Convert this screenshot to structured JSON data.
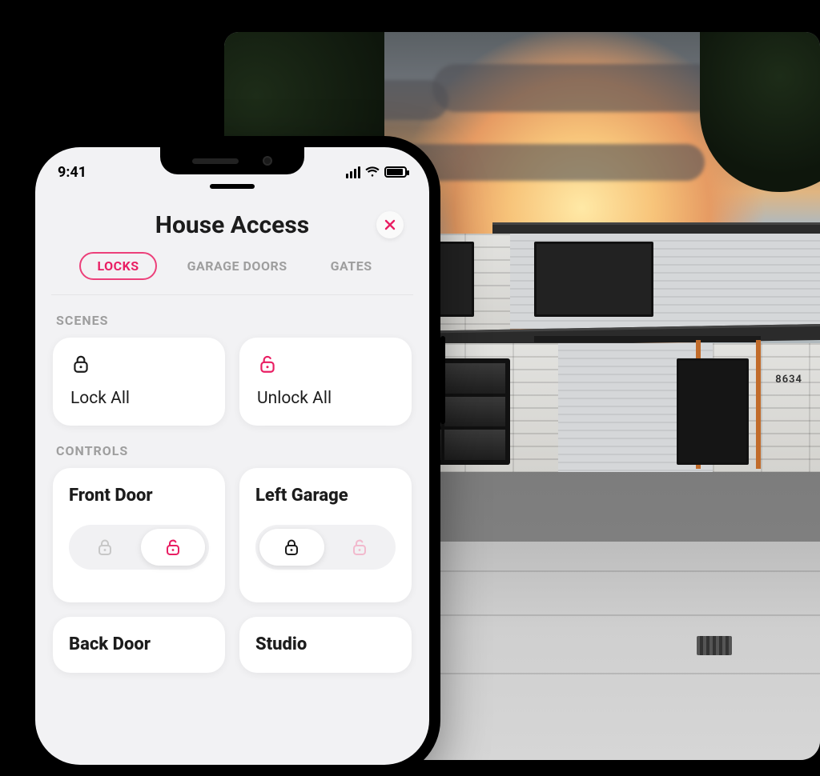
{
  "statusbar": {
    "time": "9:41"
  },
  "header": {
    "title": "House Access",
    "close_icon": "close-icon"
  },
  "tabs": [
    {
      "label": "LOCKS",
      "active": true
    },
    {
      "label": "GARAGE DOORS",
      "active": false
    },
    {
      "label": "GATES",
      "active": false
    }
  ],
  "scenes": {
    "section_label": "SCENES",
    "items": [
      {
        "label": "Lock All",
        "icon": "lock-icon",
        "color": "#1c1c1c"
      },
      {
        "label": "Unlock All",
        "icon": "lock-open-icon",
        "color": "#e91e63"
      }
    ]
  },
  "controls": {
    "section_label": "CONTROLS",
    "items": [
      {
        "label": "Front Door",
        "state": "unlocked"
      },
      {
        "label": "Left Garage",
        "state": "locked"
      },
      {
        "label": "Back Door",
        "state": null
      },
      {
        "label": "Studio",
        "state": null
      }
    ]
  },
  "colors": {
    "accent": "#e91e63",
    "grey": "#c7c7c7",
    "black": "#1c1c1c"
  },
  "background": {
    "house_number": "8634"
  }
}
